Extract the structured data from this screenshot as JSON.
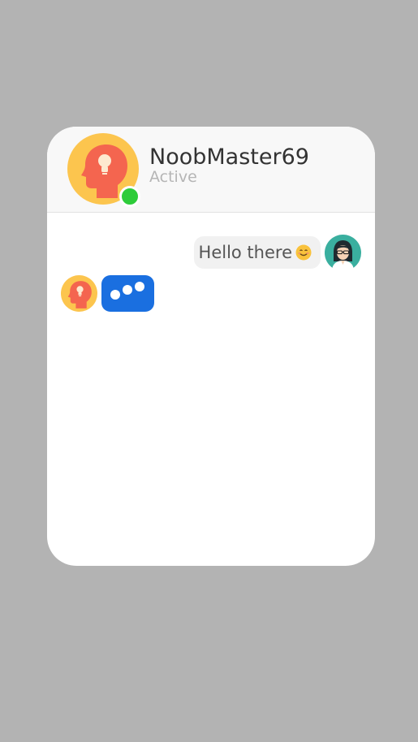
{
  "header": {
    "contact_name": "NoobMaster69",
    "status": "Active",
    "avatar_icon": "head-lightbulb-icon",
    "online_color": "#2ecc3a"
  },
  "messages": [
    {
      "direction": "outgoing",
      "text": "Hello there",
      "emoji": "smiling-face-icon",
      "avatar_icon": "woman-with-glasses-icon"
    },
    {
      "direction": "incoming",
      "typing": true,
      "avatar_icon": "head-lightbulb-icon"
    }
  ],
  "colors": {
    "background": "#b3b3b3",
    "card": "#ffffff",
    "header": "#f8f8f8",
    "outgoing_bubble": "#f1f1f1",
    "typing_bubble": "#1a6fe0"
  }
}
